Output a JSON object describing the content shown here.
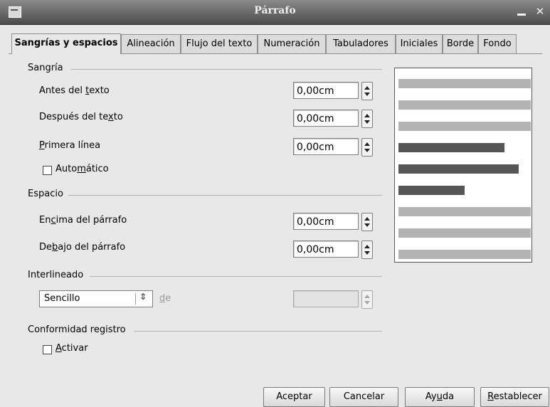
{
  "window": {
    "title": "Párrafo",
    "icons": {
      "app": "window-menu-icon",
      "minimize": "minimize-icon",
      "close": "close-icon"
    },
    "close_glyph": "✕"
  },
  "tabs": [
    "Sangrías y espacios",
    "Alineación",
    "Flujo del texto",
    "Numeración",
    "Tabuladores",
    "Iniciales",
    "Borde",
    "Fondo"
  ],
  "active_tab": 0,
  "indent": {
    "group_label": "Sangría",
    "before_text": {
      "label_a": "Antes del ",
      "label_u": "t",
      "label_b": "exto",
      "value": "0,00cm"
    },
    "after_text": {
      "label_a": "Después del te",
      "label_u": "x",
      "label_b": "to",
      "value": "0,00cm"
    },
    "first_line": {
      "label_a": "",
      "label_u": "P",
      "label_b": "rimera línea",
      "value": "0,00cm"
    },
    "automatic": {
      "label_a": "Auto",
      "label_u": "m",
      "label_b": "ático",
      "checked": false
    }
  },
  "spacing": {
    "group_label": "Espacio",
    "above": {
      "label_a": "En",
      "label_u": "c",
      "label_b": "ima del párrafo",
      "value": "0,00cm"
    },
    "below": {
      "label_a": "De",
      "label_u": "b",
      "label_b": "ajo del párrafo",
      "value": "0,00cm"
    }
  },
  "line_spacing": {
    "group_label": "Interlineado",
    "selected": "Sencillo",
    "of_label_u": "d",
    "of_label_b": "e",
    "value": ""
  },
  "register": {
    "group_label": "Conformidad registro",
    "activate": {
      "label_a": "",
      "label_u": "A",
      "label_b": "ctivar",
      "checked": false
    }
  },
  "preview": {
    "colors": {
      "context": "#b3b3b3",
      "paragraph": "#555555"
    },
    "lines": [
      {
        "role": "context",
        "fill": 1.0
      },
      {
        "role": "context",
        "fill": 1.0
      },
      {
        "role": "context",
        "fill": 1.0
      },
      {
        "role": "paragraph",
        "fill": 0.8
      },
      {
        "role": "paragraph",
        "fill": 0.91
      },
      {
        "role": "paragraph",
        "fill": 0.5
      },
      {
        "role": "context",
        "fill": 1.0
      },
      {
        "role": "context",
        "fill": 1.0
      },
      {
        "role": "context",
        "fill": 1.0
      }
    ]
  },
  "buttons": {
    "ok": "Aceptar",
    "cancel": "Cancelar",
    "help_a": "Ay",
    "help_u": "u",
    "help_b": "da",
    "reset_a": "",
    "reset_u": "R",
    "reset_b": "establecer"
  }
}
